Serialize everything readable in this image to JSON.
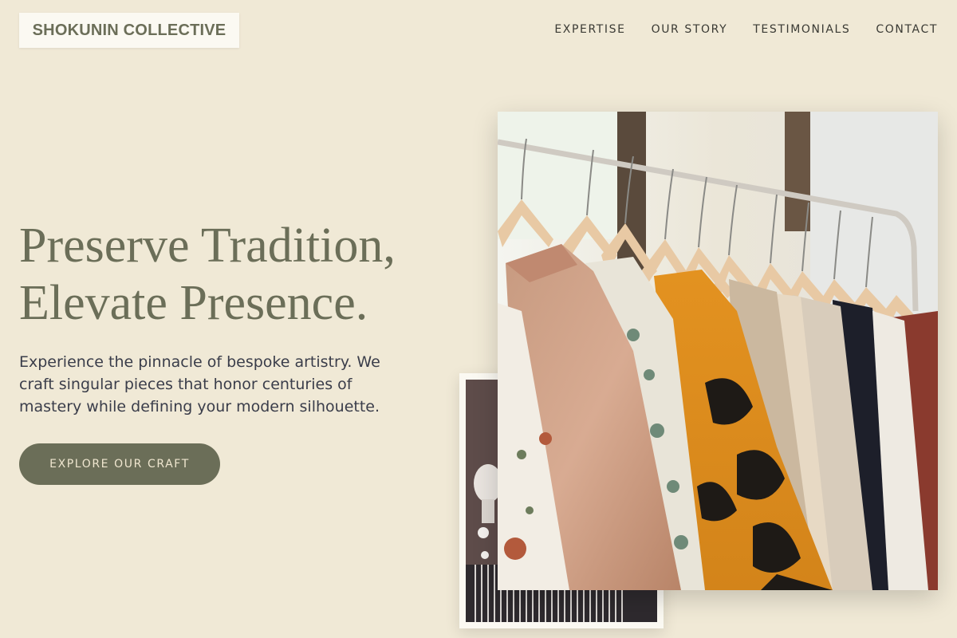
{
  "brand": {
    "name": "SHOKUNIN COLLECTIVE"
  },
  "nav": {
    "items": [
      {
        "label": "EXPERTISE"
      },
      {
        "label": "OUR STORY"
      },
      {
        "label": "TESTIMONIALS"
      },
      {
        "label": "CONTACT"
      }
    ]
  },
  "hero": {
    "headline_line1": "Preserve Tradition,",
    "headline_line2": "Elevate Presence.",
    "subtext": "Experience the pinnacle of bespoke artistry. We craft singular pieces that honor centuries of mastery while defining your modern silhouette.",
    "cta_label": "EXPLORE OUR CRAFT"
  },
  "images": {
    "main": "clothing-rack-photo",
    "secondary": "mannequin-boutique-photo"
  },
  "colors": {
    "background": "#f0e9d6",
    "accent": "#6b6e58",
    "text": "#3a3d4a"
  }
}
